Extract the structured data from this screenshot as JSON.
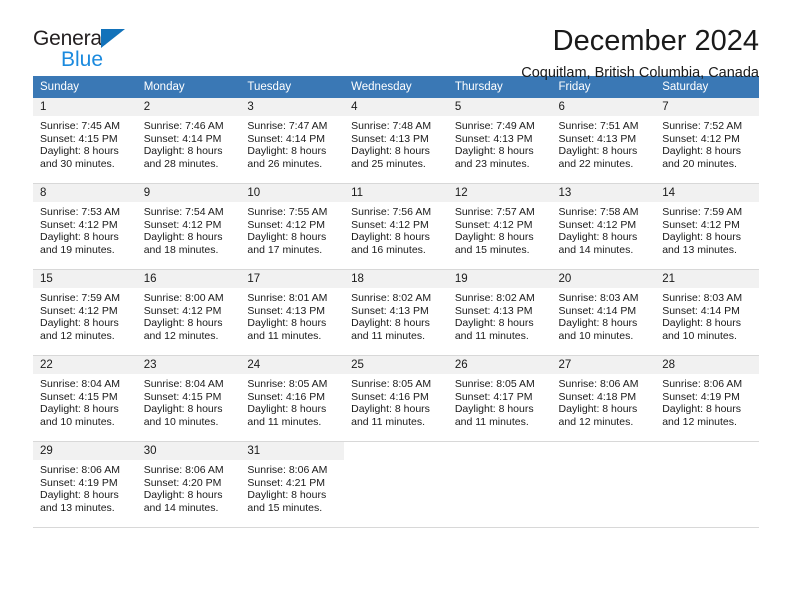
{
  "brand": {
    "name_part1": "General",
    "name_part2": "Blue",
    "triangle_color": "#1272ba",
    "blue_text_color": "#1b8ade",
    "dark_text_color": "#231f20"
  },
  "header": {
    "title": "December 2024",
    "subtitle": "Coquitlam, British Columbia, Canada"
  },
  "theme": {
    "header_row_bg": "#3a78b5",
    "daynum_bg": "#f1f1f1",
    "cell_border": "#d8d8d8",
    "text": "#1a1a1a"
  },
  "weekdays": [
    "Sunday",
    "Monday",
    "Tuesday",
    "Wednesday",
    "Thursday",
    "Friday",
    "Saturday"
  ],
  "weeks": [
    {
      "days": [
        {
          "date": "1",
          "sunrise": "Sunrise: 7:45 AM",
          "sunset": "Sunset: 4:15 PM",
          "daylight_line1": "Daylight: 8 hours",
          "daylight_line2": "and 30 minutes."
        },
        {
          "date": "2",
          "sunrise": "Sunrise: 7:46 AM",
          "sunset": "Sunset: 4:14 PM",
          "daylight_line1": "Daylight: 8 hours",
          "daylight_line2": "and 28 minutes."
        },
        {
          "date": "3",
          "sunrise": "Sunrise: 7:47 AM",
          "sunset": "Sunset: 4:14 PM",
          "daylight_line1": "Daylight: 8 hours",
          "daylight_line2": "and 26 minutes."
        },
        {
          "date": "4",
          "sunrise": "Sunrise: 7:48 AM",
          "sunset": "Sunset: 4:13 PM",
          "daylight_line1": "Daylight: 8 hours",
          "daylight_line2": "and 25 minutes."
        },
        {
          "date": "5",
          "sunrise": "Sunrise: 7:49 AM",
          "sunset": "Sunset: 4:13 PM",
          "daylight_line1": "Daylight: 8 hours",
          "daylight_line2": "and 23 minutes."
        },
        {
          "date": "6",
          "sunrise": "Sunrise: 7:51 AM",
          "sunset": "Sunset: 4:13 PM",
          "daylight_line1": "Daylight: 8 hours",
          "daylight_line2": "and 22 minutes."
        },
        {
          "date": "7",
          "sunrise": "Sunrise: 7:52 AM",
          "sunset": "Sunset: 4:12 PM",
          "daylight_line1": "Daylight: 8 hours",
          "daylight_line2": "and 20 minutes."
        }
      ]
    },
    {
      "days": [
        {
          "date": "8",
          "sunrise": "Sunrise: 7:53 AM",
          "sunset": "Sunset: 4:12 PM",
          "daylight_line1": "Daylight: 8 hours",
          "daylight_line2": "and 19 minutes."
        },
        {
          "date": "9",
          "sunrise": "Sunrise: 7:54 AM",
          "sunset": "Sunset: 4:12 PM",
          "daylight_line1": "Daylight: 8 hours",
          "daylight_line2": "and 18 minutes."
        },
        {
          "date": "10",
          "sunrise": "Sunrise: 7:55 AM",
          "sunset": "Sunset: 4:12 PM",
          "daylight_line1": "Daylight: 8 hours",
          "daylight_line2": "and 17 minutes."
        },
        {
          "date": "11",
          "sunrise": "Sunrise: 7:56 AM",
          "sunset": "Sunset: 4:12 PM",
          "daylight_line1": "Daylight: 8 hours",
          "daylight_line2": "and 16 minutes."
        },
        {
          "date": "12",
          "sunrise": "Sunrise: 7:57 AM",
          "sunset": "Sunset: 4:12 PM",
          "daylight_line1": "Daylight: 8 hours",
          "daylight_line2": "and 15 minutes."
        },
        {
          "date": "13",
          "sunrise": "Sunrise: 7:58 AM",
          "sunset": "Sunset: 4:12 PM",
          "daylight_line1": "Daylight: 8 hours",
          "daylight_line2": "and 14 minutes."
        },
        {
          "date": "14",
          "sunrise": "Sunrise: 7:59 AM",
          "sunset": "Sunset: 4:12 PM",
          "daylight_line1": "Daylight: 8 hours",
          "daylight_line2": "and 13 minutes."
        }
      ]
    },
    {
      "days": [
        {
          "date": "15",
          "sunrise": "Sunrise: 7:59 AM",
          "sunset": "Sunset: 4:12 PM",
          "daylight_line1": "Daylight: 8 hours",
          "daylight_line2": "and 12 minutes."
        },
        {
          "date": "16",
          "sunrise": "Sunrise: 8:00 AM",
          "sunset": "Sunset: 4:12 PM",
          "daylight_line1": "Daylight: 8 hours",
          "daylight_line2": "and 12 minutes."
        },
        {
          "date": "17",
          "sunrise": "Sunrise: 8:01 AM",
          "sunset": "Sunset: 4:13 PM",
          "daylight_line1": "Daylight: 8 hours",
          "daylight_line2": "and 11 minutes."
        },
        {
          "date": "18",
          "sunrise": "Sunrise: 8:02 AM",
          "sunset": "Sunset: 4:13 PM",
          "daylight_line1": "Daylight: 8 hours",
          "daylight_line2": "and 11 minutes."
        },
        {
          "date": "19",
          "sunrise": "Sunrise: 8:02 AM",
          "sunset": "Sunset: 4:13 PM",
          "daylight_line1": "Daylight: 8 hours",
          "daylight_line2": "and 11 minutes."
        },
        {
          "date": "20",
          "sunrise": "Sunrise: 8:03 AM",
          "sunset": "Sunset: 4:14 PM",
          "daylight_line1": "Daylight: 8 hours",
          "daylight_line2": "and 10 minutes."
        },
        {
          "date": "21",
          "sunrise": "Sunrise: 8:03 AM",
          "sunset": "Sunset: 4:14 PM",
          "daylight_line1": "Daylight: 8 hours",
          "daylight_line2": "and 10 minutes."
        }
      ]
    },
    {
      "days": [
        {
          "date": "22",
          "sunrise": "Sunrise: 8:04 AM",
          "sunset": "Sunset: 4:15 PM",
          "daylight_line1": "Daylight: 8 hours",
          "daylight_line2": "and 10 minutes."
        },
        {
          "date": "23",
          "sunrise": "Sunrise: 8:04 AM",
          "sunset": "Sunset: 4:15 PM",
          "daylight_line1": "Daylight: 8 hours",
          "daylight_line2": "and 10 minutes."
        },
        {
          "date": "24",
          "sunrise": "Sunrise: 8:05 AM",
          "sunset": "Sunset: 4:16 PM",
          "daylight_line1": "Daylight: 8 hours",
          "daylight_line2": "and 11 minutes."
        },
        {
          "date": "25",
          "sunrise": "Sunrise: 8:05 AM",
          "sunset": "Sunset: 4:16 PM",
          "daylight_line1": "Daylight: 8 hours",
          "daylight_line2": "and 11 minutes."
        },
        {
          "date": "26",
          "sunrise": "Sunrise: 8:05 AM",
          "sunset": "Sunset: 4:17 PM",
          "daylight_line1": "Daylight: 8 hours",
          "daylight_line2": "and 11 minutes."
        },
        {
          "date": "27",
          "sunrise": "Sunrise: 8:06 AM",
          "sunset": "Sunset: 4:18 PM",
          "daylight_line1": "Daylight: 8 hours",
          "daylight_line2": "and 12 minutes."
        },
        {
          "date": "28",
          "sunrise": "Sunrise: 8:06 AM",
          "sunset": "Sunset: 4:19 PM",
          "daylight_line1": "Daylight: 8 hours",
          "daylight_line2": "and 12 minutes."
        }
      ]
    },
    {
      "days": [
        {
          "date": "29",
          "sunrise": "Sunrise: 8:06 AM",
          "sunset": "Sunset: 4:19 PM",
          "daylight_line1": "Daylight: 8 hours",
          "daylight_line2": "and 13 minutes."
        },
        {
          "date": "30",
          "sunrise": "Sunrise: 8:06 AM",
          "sunset": "Sunset: 4:20 PM",
          "daylight_line1": "Daylight: 8 hours",
          "daylight_line2": "and 14 minutes."
        },
        {
          "date": "31",
          "sunrise": "Sunrise: 8:06 AM",
          "sunset": "Sunset: 4:21 PM",
          "daylight_line1": "Daylight: 8 hours",
          "daylight_line2": "and 15 minutes."
        },
        {
          "date": "",
          "sunrise": "",
          "sunset": "",
          "daylight_line1": "",
          "daylight_line2": ""
        },
        {
          "date": "",
          "sunrise": "",
          "sunset": "",
          "daylight_line1": "",
          "daylight_line2": ""
        },
        {
          "date": "",
          "sunrise": "",
          "sunset": "",
          "daylight_line1": "",
          "daylight_line2": ""
        },
        {
          "date": "",
          "sunrise": "",
          "sunset": "",
          "daylight_line1": "",
          "daylight_line2": ""
        }
      ]
    }
  ]
}
